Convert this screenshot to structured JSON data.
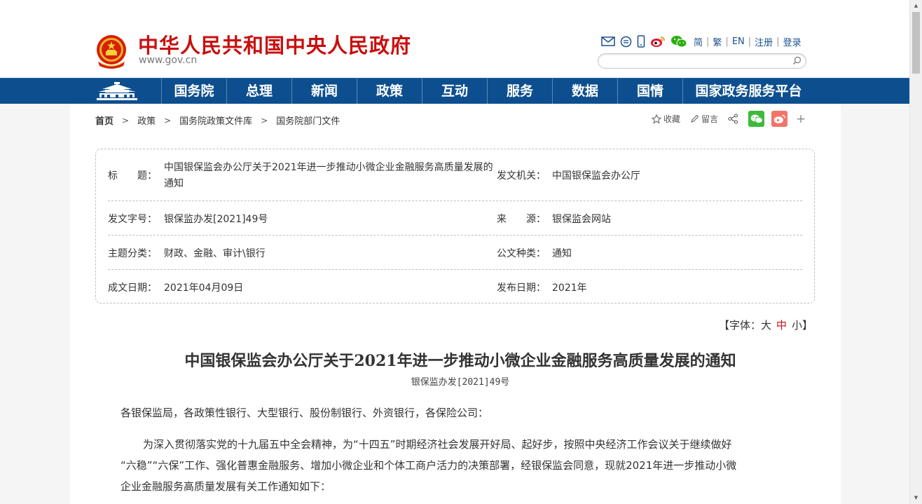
{
  "header": {
    "site_title": "中华人民共和国中央人民政府",
    "site_url": "www.gov.cn",
    "tool_icons": [
      "mail-icon",
      "message-icon",
      "mobile-icon",
      "weibo-icon",
      "wechat-icon"
    ],
    "lang_links": [
      "简",
      "繁",
      "EN",
      "注册",
      "登录"
    ],
    "search_placeholder": ""
  },
  "nav": {
    "items": [
      "国务院",
      "总理",
      "新闻",
      "政策",
      "互动",
      "服务",
      "数据",
      "国情",
      "国家政务服务平台"
    ]
  },
  "breadcrumb": [
    "首页",
    "政策",
    "国务院政策文件库",
    "国务院部门文件"
  ],
  "actions": {
    "favorite": "收藏",
    "comment": "留言",
    "more": "+"
  },
  "meta": {
    "title_label": "标　　题：",
    "title_line1": "中国银保监会办公厅关于2021年进一步推动小微企业金融服务高质量发展的",
    "title_line2": "通知",
    "issuer_label": "发文机关：",
    "issuer": "中国银保监会办公厅",
    "doc_no_label": "发文字号：",
    "doc_no": "银保监办发[2021]49号",
    "source_label": "来　　源：",
    "source": "银保监会网站",
    "topic_label": "主题分类：",
    "topic": "财政、金融、审计\\银行",
    "type_label": "公文种类：",
    "type": "通知",
    "date_label": "成文日期：",
    "date": "2021年04月09日",
    "publish_label": "发布日期：",
    "publish": "2021年"
  },
  "font_size": {
    "prefix": "【字体：",
    "large": "大",
    "medium": "中",
    "small": "小",
    "suffix": "】"
  },
  "document": {
    "title": "中国银保监会办公厅关于2021年进一步推动小微企业金融服务高质量发展的通知",
    "number": "银保监办发[2021]49号",
    "salutation": "各银保监局，各政策性银行、大型银行、股份制银行、外资银行，各保险公司：",
    "para1_line1": "为深入贯彻落实党的十九届五中全会精神，为“十四五”时期经济社会发展开好局、起好步，按照中央经济工作会议关于继续做好",
    "para1_line2": "“六稳”“六保”工作、强化普惠金融服务、增加小微企业和个体工商户活力的决策部署，经银保监会同意，现就2021年进一步推动小微",
    "para1_line3": "企业金融服务高质量发展有关工作通知如下："
  }
}
